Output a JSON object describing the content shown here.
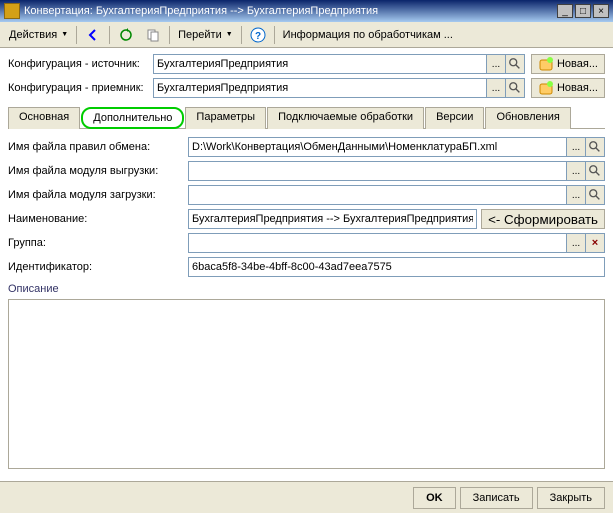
{
  "title": "Конвертация: БухгалтерияПредприятия --> БухгалтерияПредприятия",
  "toolbar": {
    "actions": "Действия",
    "goto": "Перейти",
    "info": "Информация по обработчикам ..."
  },
  "config": {
    "source_label": "Конфигурация - источник:",
    "source_value": "БухгалтерияПредприятия",
    "dest_label": "Конфигурация - приемник:",
    "dest_value": "БухгалтерияПредприятия",
    "new_btn": "Новая..."
  },
  "tabs": {
    "main": "Основная",
    "additional": "Дополнительно",
    "params": "Параметры",
    "plugins": "Подключаемые обработки",
    "versions": "Версии",
    "updates": "Обновления"
  },
  "form": {
    "rules_file_label": "Имя файла правил обмена:",
    "rules_file_value": "D:\\Work\\Конвертация\\ОбменДанными\\НоменклатураБП.xml",
    "export_module_label": "Имя файла модуля выгрузки:",
    "export_module_value": "",
    "import_module_label": "Имя файла модуля загрузки:",
    "import_module_value": "",
    "name_label": "Наименование:",
    "name_value": "БухгалтерияПредприятия --> БухгалтерияПредприятия",
    "generate_btn": "<- Сформировать",
    "group_label": "Группа:",
    "group_value": "",
    "id_label": "Идентификатор:",
    "id_value": "6baca5f8-34be-4bff-8c00-43ad7eea7575",
    "desc_label": "Описание"
  },
  "footer": {
    "ok": "OK",
    "save": "Записать",
    "close": "Закрыть"
  }
}
